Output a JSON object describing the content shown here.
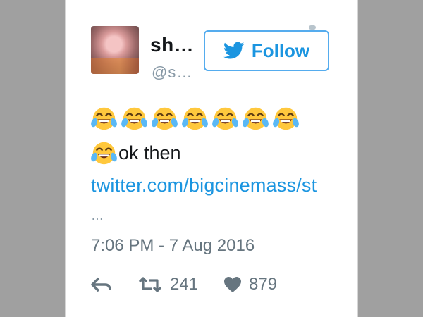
{
  "user": {
    "display_name": "sh…",
    "handle": "@s…"
  },
  "follow_button": {
    "label": "Follow",
    "icon": "twitter-bird-icon"
  },
  "tweet": {
    "emoji": "face-with-tears-of-joy",
    "emoji_count_first_line": 7,
    "text": "ok then",
    "link": "twitter.com/bigcinemass/st",
    "ellipsis": "…",
    "timestamp": "7:06 PM - 7 Aug 2016"
  },
  "actions": {
    "reply_icon": "reply-icon",
    "retweet_icon": "retweet-icon",
    "retweet_count": "241",
    "like_icon": "heart-icon",
    "like_count": "879"
  },
  "colors": {
    "accent": "#1b95e0",
    "text": "#14171a",
    "muted": "#66757f",
    "background": "#a0a0a0"
  }
}
